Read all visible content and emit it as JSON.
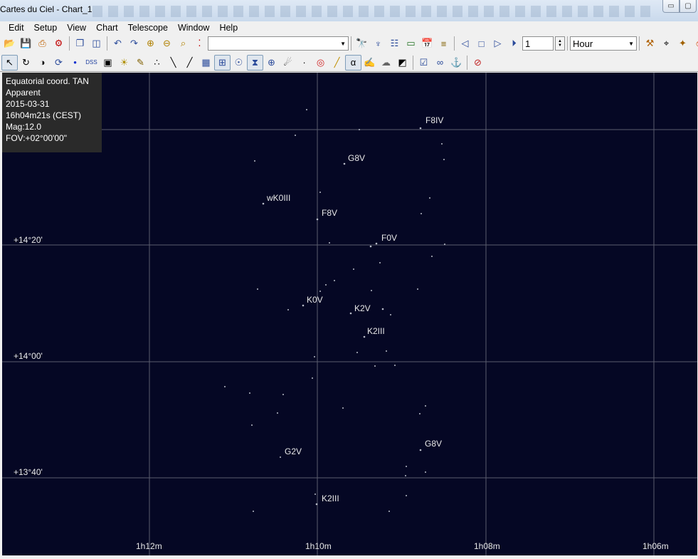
{
  "window": {
    "title": "Cartes du Ciel - Chart_1",
    "min_glyph": "▭",
    "max_glyph": "▢"
  },
  "menu": [
    "Edit",
    "Setup",
    "View",
    "Chart",
    "Telescope",
    "Window",
    "Help"
  ],
  "toolbar": {
    "search_value": "",
    "frame_value": "1",
    "time_unit": "Hour"
  },
  "info": {
    "projection": "Equatorial coord. TAN",
    "mode": "Apparent",
    "date": "2015-03-31",
    "time": "16h04m21s (CEST)",
    "mag": "Mag:12.0",
    "fov": "FOV:+02°00'00\""
  },
  "colors": {
    "sky": "#050724",
    "grid": "#5a5d6e",
    "label": "#e8e8e8",
    "star": "#b8bcc8"
  },
  "chart_data": {
    "type": "scatter",
    "ra_ticks": [
      "1h12m",
      "1h10m",
      "1h08m",
      "1h06m"
    ],
    "dec_ticks": [
      "+14°20'",
      "+14°00'",
      "+13°40'"
    ],
    "star_labels": [
      "F8IV",
      "G8V",
      "wK0III",
      "F8V",
      "F0V",
      "K0V",
      "K2V",
      "K2III",
      "G8V",
      "G2V",
      "K2III"
    ]
  }
}
